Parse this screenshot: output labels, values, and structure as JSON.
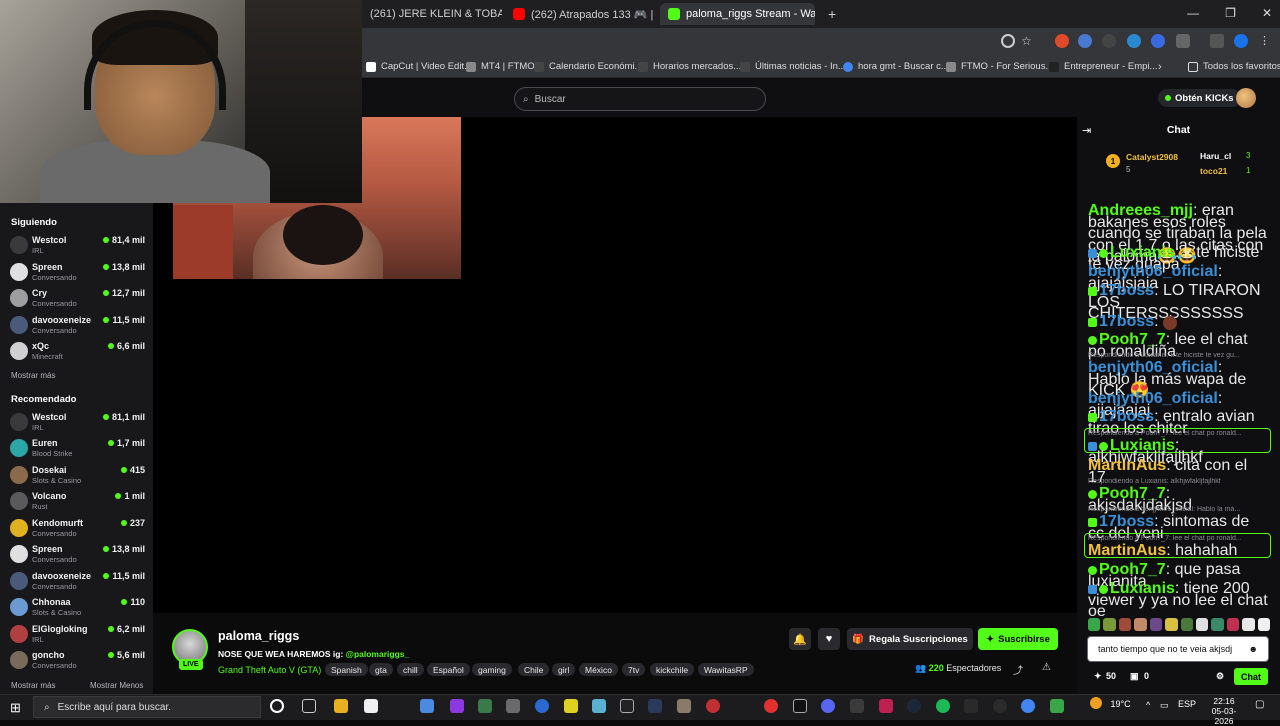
{
  "browser": {
    "tabs": [
      {
        "label": "(261) JERE KLEIN & TOBAL MJ ...",
        "color": "#ff0000"
      },
      {
        "label": "(262) Atrapados 133 🎮 | Cap...",
        "color": "#ff0000"
      },
      {
        "label": "paloma_riggs Stream - Wat...",
        "color": "#53fc18"
      }
    ],
    "new_tab": "+",
    "bookmarks": [
      {
        "label": "CapCut | Video Edit...",
        "color": "#ffffff"
      },
      {
        "label": "MT4 | FTMO",
        "color": "#888888"
      },
      {
        "label": "Calendario Económi...",
        "color": "#444444"
      },
      {
        "label": "Horarios mercados...",
        "color": "#444444"
      },
      {
        "label": "Últimas noticias - In...",
        "color": "#444444"
      },
      {
        "label": "hora gmt - Buscar c...",
        "color": "#4285f4"
      },
      {
        "label": "FTMO - For Serious...",
        "color": "#888888"
      },
      {
        "label": "Entrepreneur - Empi...",
        "color": "#222222"
      }
    ],
    "bookmarks_more": "›",
    "all_favorites": "Todos los favoritos"
  },
  "header": {
    "search_placeholder": "Buscar",
    "get_kicks": "Obtén KICKs"
  },
  "sidebar": {
    "following_title": "Siguiendo",
    "following": [
      {
        "name": "Westcol",
        "category": "IRL",
        "viewers": "81,4 mil",
        "color": "#3a3a3a"
      },
      {
        "name": "Spreen",
        "category": "Conversando",
        "viewers": "13,8 mil",
        "color": "#e0e0e0"
      },
      {
        "name": "Cry",
        "category": "Conversando",
        "viewers": "12,7 mil",
        "color": "#9e9e9e"
      },
      {
        "name": "davooxeneize",
        "category": "Conversando",
        "viewers": "11,5 mil",
        "color": "#4a5a7a"
      },
      {
        "name": "xQc",
        "category": "Minecraft",
        "viewers": "6,6 mil",
        "color": "#d0d0d0"
      }
    ],
    "following_more": "Mostrar más",
    "recommended_title": "Recomendado",
    "recommended": [
      {
        "name": "Westcol",
        "category": "IRL",
        "viewers": "81,1 mil",
        "color": "#3a3a3a"
      },
      {
        "name": "Euren",
        "category": "Blood Strike",
        "viewers": "1,7 mil",
        "color": "#2aa6a6"
      },
      {
        "name": "Dosekai",
        "category": "Slots & Casino",
        "viewers": "415",
        "color": "#8a6a4a"
      },
      {
        "name": "Volcano",
        "category": "Rust",
        "viewers": "1 mil",
        "color": "#5a5a5a"
      },
      {
        "name": "Kendomurft",
        "category": "Conversando",
        "viewers": "237",
        "color": "#e0b020"
      },
      {
        "name": "Spreen",
        "category": "Conversando",
        "viewers": "13,8 mil",
        "color": "#e0e0e0"
      },
      {
        "name": "davooxeneize",
        "category": "Conversando",
        "viewers": "11,5 mil",
        "color": "#4a5a7a"
      },
      {
        "name": "Chhonaa",
        "category": "Slots & Casino",
        "viewers": "110",
        "color": "#6a9ad0"
      },
      {
        "name": "ElGlogloking",
        "category": "IRL",
        "viewers": "6,2 mil",
        "color": "#b04040"
      },
      {
        "name": "goncho",
        "category": "Conversando",
        "viewers": "5,6 mil",
        "color": "#7a6a5a"
      }
    ],
    "recommended_more": "Mostrar más",
    "recommended_less": "Mostrar Menos"
  },
  "stream": {
    "streamer": "paloma_riggs",
    "live": "LIVE",
    "title": "NOSE QUE WEA HAREMOS ig: ",
    "title_ig": "@palomariggs_",
    "category": "Grand Theft Auto V (GTA)",
    "tags": [
      "Spanish",
      "gta",
      "chill",
      "Español",
      "gaming",
      "Chile",
      "girl",
      "México",
      "7tv",
      "kickchile",
      "WawitasRP"
    ],
    "gift_label": "Regala Suscripciones",
    "subscribe_label": "Suscribirse",
    "viewers": "220",
    "viewers_label": "Espectadores"
  },
  "chat": {
    "title": "Chat",
    "leaderboard": [
      {
        "name": "Catalyst2908",
        "count": "5"
      },
      {
        "name": "Haru_cl",
        "count": "3"
      },
      {
        "name": "toco21",
        "count": "1"
      }
    ],
    "messages": [
      {
        "user": "Andreees_mjj",
        "color": "#53fc18",
        "text": "eran bakanes esos roles cuando se tiraban la pela con el 1.7 o las citas con la paloma😂😂"
      },
      {
        "user": "Luxianis",
        "color": "#53fc18",
        "text": "k te hiciste te vez guapa"
      },
      {
        "user": "benjyth06_oficial",
        "color": "#3a8fd6",
        "text": "ajajajsjaja"
      },
      {
        "user": "17boss",
        "color": "#3a8fd6",
        "text": "LO TIRARON LOS CHITERSSSSSSSSS"
      },
      {
        "user": "17boss",
        "color": "#3a8fd6",
        "text": ""
      },
      {
        "user": "Pooh7_7",
        "color": "#53fc18",
        "text": "lee el chat po ronaldiña"
      },
      {
        "user": "benjyth06_oficial",
        "color": "#3a8fd6",
        "text": "Hablo la más wapa de KICK 😍"
      },
      {
        "user": "benjyth06_oficial",
        "color": "#3a8fd6",
        "text": "ajjajaajaj"
      },
      {
        "user": "17boss",
        "color": "#3a8fd6",
        "text": "entralo avian tirao los chiter"
      },
      {
        "user": "Luxianis",
        "color": "#53fc18",
        "text": "alkhjwfakljfajlhkf"
      },
      {
        "user": "MartinAus",
        "color": "#f0c040",
        "text": "cita con el 17"
      },
      {
        "user": "Pooh7_7",
        "color": "#53fc18",
        "text": "akjsdakjdakjsd"
      },
      {
        "user": "17boss",
        "color": "#3a8fd6",
        "text": "sintomas de cc del yeni"
      },
      {
        "user": "MartinAus",
        "color": "#f0c040",
        "text": "hahahah"
      },
      {
        "user": "Pooh7_7",
        "color": "#53fc18",
        "text": "que pasa luxianita"
      },
      {
        "user": "Luxianis",
        "color": "#53fc18",
        "text": "tiene 200 viewer y ya no lee el chat oe"
      }
    ],
    "replies": [
      "Respondiendo a Luxianis: k te hiciste te vez gu...",
      "Respondiendo a Pooh7_7: lee el chat po ronald...",
      "Respondiendo a Luxianis: alkhjwfakljfajlhkf",
      "Respondiendo a benjyth06_oficial: Hablo la má...",
      "Respondiendo a Pooh7_7: lee el chat po ronald..."
    ],
    "input_value": "tanto tiempo que no te veia akjsdj",
    "points": "50",
    "zero": "0",
    "send_label": "Chat"
  },
  "taskbar": {
    "search_placeholder": "Escribe aquí para buscar.",
    "temp": "19°C",
    "lang": "ESP",
    "time": "22:16",
    "date": "05-03-2026"
  }
}
